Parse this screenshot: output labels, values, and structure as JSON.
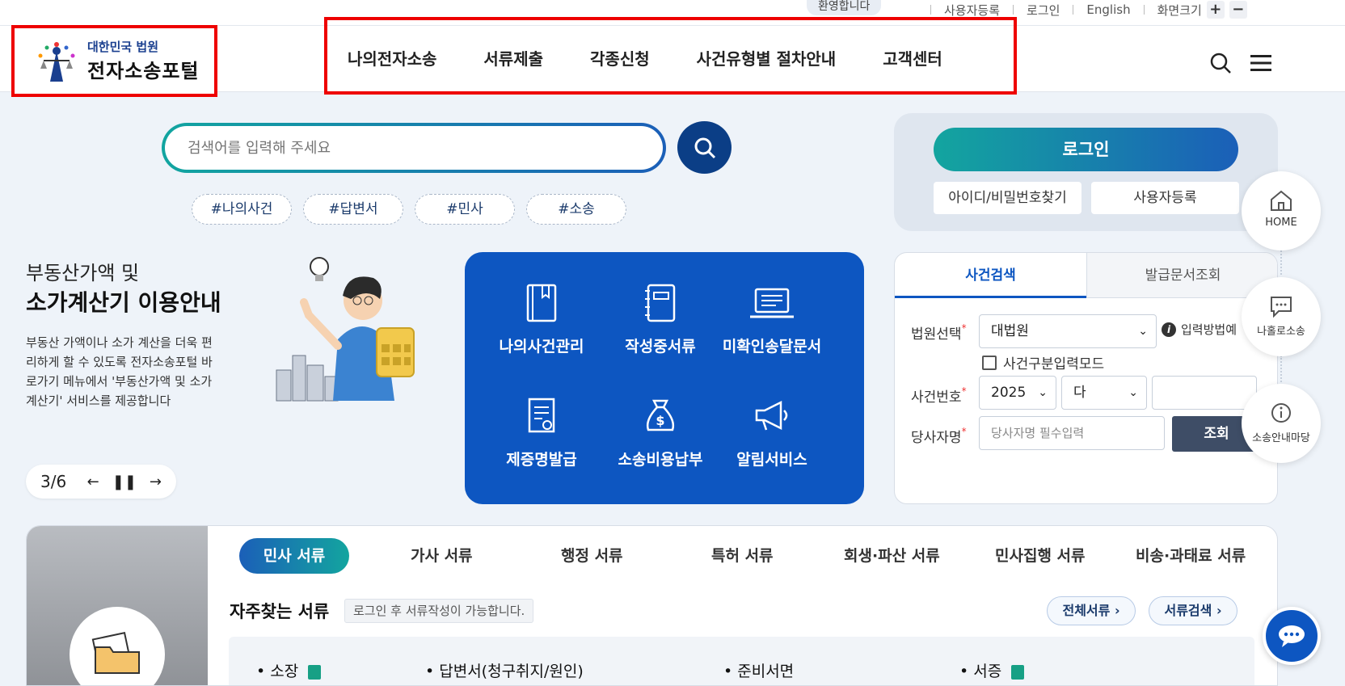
{
  "topbar": {
    "welcome": "환영합니다",
    "links": [
      "사용자등록",
      "로그인",
      "English",
      "화면크기"
    ],
    "zoom_in": "+",
    "zoom_out": "−"
  },
  "logo": {
    "small": "대한민국 법원",
    "big": "전자소송포털"
  },
  "gnb": [
    "나의전자소송",
    "서류제출",
    "각종신청",
    "사건유형별 절차안내",
    "고객센터"
  ],
  "search": {
    "placeholder": "검색어를 입력해 주세요"
  },
  "tags": [
    "#나의사건",
    "#답변서",
    "#민사",
    "#소송"
  ],
  "banner": {
    "subtitle": "부동산가액 및",
    "title": "소가계산기 이용안내",
    "desc": "부동산 가액이나 소가 계산을 더욱 편리하게 할 수 있도록 전자소송포털 바로가기 메뉴에서 '부동산가액 및 소가계산기' 서비스를 제공합니다",
    "pager": "3/6"
  },
  "quick": [
    "나의사건관리",
    "작성중서류",
    "미확인송달문서",
    "제증명발급",
    "소송비용납부",
    "알림서비스"
  ],
  "login": {
    "button": "로그인",
    "find": "아이디/비밀번호찾기",
    "register": "사용자등록"
  },
  "case_search": {
    "tabs": [
      "사건검색",
      "발급문서조회"
    ],
    "court_label": "법원선택",
    "court_value": "대법원",
    "info": "입력방법예",
    "checkbox": "사건구분입력모드",
    "case_no_label": "사건번호",
    "year": "2025",
    "type": "다",
    "party_label": "당사자명",
    "party_placeholder": "당사자명 필수입력",
    "submit": "조회"
  },
  "side": [
    "HOME",
    "나홀로소송",
    "소송안내마당"
  ],
  "docs": {
    "tabs": [
      "민사 서류",
      "가사 서류",
      "행정 서류",
      "특허 서류",
      "회생·파산 서류",
      "민사집행 서류",
      "비송·과태료 서류"
    ],
    "fav_title": "자주찾는 서류",
    "fav_note": "로그인 후 서류작성이 가능합니다.",
    "all_docs": "전체서류",
    "doc_search": "서류검색",
    "items": [
      "• 소장",
      "• 답변서(청구취지/원인)",
      "• 준비서면",
      "• 서증"
    ]
  },
  "colors": {
    "primary": "#0d56c1",
    "navy": "#0b3e86",
    "teal": "#13a59f",
    "highlight": "#e00000"
  }
}
